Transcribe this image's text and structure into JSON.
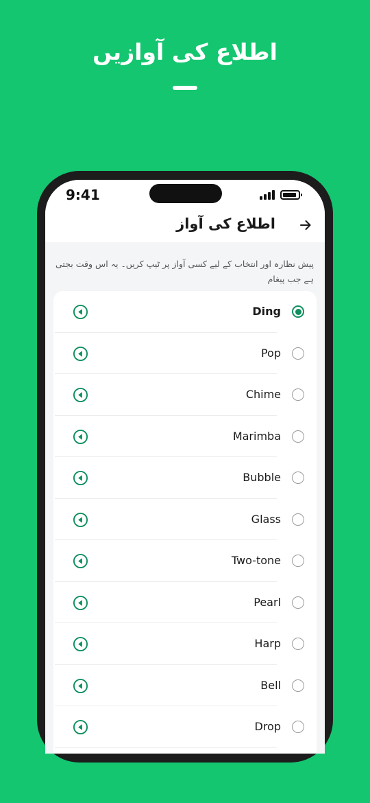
{
  "promo": {
    "title": "اطلاع کی آوازیں"
  },
  "status_bar": {
    "time": "9:41"
  },
  "header": {
    "title": "اطلاع کی آواز",
    "back_icon": "arrow-right-icon"
  },
  "description": "پیش نظارہ اور انتخاب کے لیے کسی آواز پر ٹیپ کریں۔ یہ اس وقت بجتی ہے جب پیغام",
  "colors": {
    "brand": "#13c66f",
    "accent": "#0d8f5e"
  },
  "sounds": [
    {
      "label": "Ding",
      "selected": true
    },
    {
      "label": "Pop",
      "selected": false
    },
    {
      "label": "Chime",
      "selected": false
    },
    {
      "label": "Marimba",
      "selected": false
    },
    {
      "label": "Bubble",
      "selected": false
    },
    {
      "label": "Glass",
      "selected": false
    },
    {
      "label": "Two-tone",
      "selected": false
    },
    {
      "label": "Pearl",
      "selected": false
    },
    {
      "label": "Harp",
      "selected": false
    },
    {
      "label": "Bell",
      "selected": false
    },
    {
      "label": "Drop",
      "selected": false
    }
  ]
}
